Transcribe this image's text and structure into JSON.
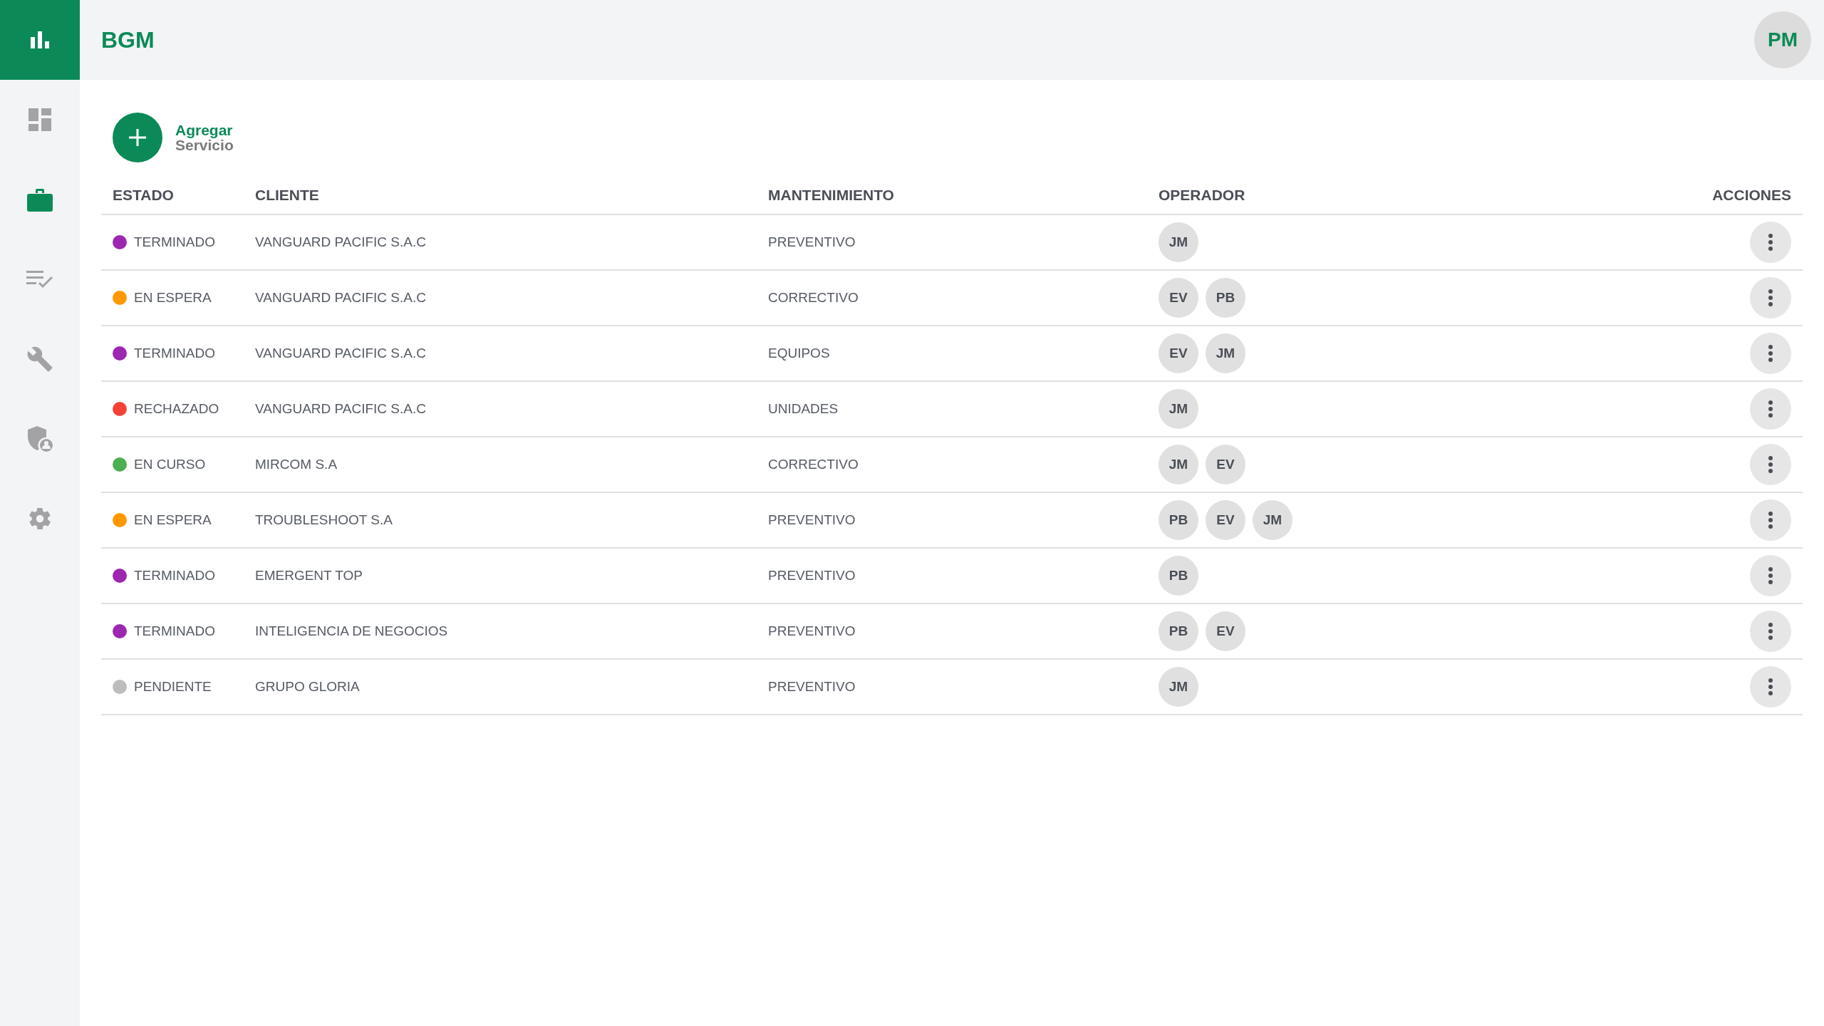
{
  "header": {
    "brand": "BGM",
    "user_initials": "PM"
  },
  "sidebar": {
    "items": [
      {
        "kind": "dashboard",
        "selected": false
      },
      {
        "kind": "services",
        "selected": true
      },
      {
        "kind": "checklist",
        "selected": false
      },
      {
        "kind": "tools",
        "selected": false
      },
      {
        "kind": "security",
        "selected": false
      },
      {
        "kind": "settings",
        "selected": false
      }
    ]
  },
  "add_button": {
    "label_line_1": "Agregar",
    "label_line_2": "Servicio"
  },
  "table": {
    "columns": [
      "ESTADO",
      "CLIENTE",
      "MANTENIMIENTO",
      "OPERADOR",
      "ACCIONES"
    ],
    "rows": [
      {
        "status": "TERMINADO",
        "color": "#9c27b0",
        "client": "VANGUARD PACIFIC S.A.C",
        "maintenance": "PREVENTIVO",
        "operators": [
          "JM"
        ]
      },
      {
        "status": "EN ESPERA",
        "color": "#ff9800",
        "client": "VANGUARD PACIFIC S.A.C",
        "maintenance": "CORRECTIVO",
        "operators": [
          "EV",
          "PB"
        ]
      },
      {
        "status": "TERMINADO",
        "color": "#9c27b0",
        "client": "VANGUARD PACIFIC S.A.C",
        "maintenance": "EQUIPOS",
        "operators": [
          "EV",
          "JM"
        ]
      },
      {
        "status": "RECHAZADO",
        "color": "#f44336",
        "client": "VANGUARD PACIFIC S.A.C",
        "maintenance": "UNIDADES",
        "operators": [
          "JM"
        ]
      },
      {
        "status": "EN CURSO",
        "color": "#4caf50",
        "client": "MIRCOM S.A",
        "maintenance": "CORRECTIVO",
        "operators": [
          "JM",
          "EV"
        ]
      },
      {
        "status": "EN ESPERA",
        "color": "#ff9800",
        "client": "TROUBLESHOOT S.A",
        "maintenance": "PREVENTIVO",
        "operators": [
          "PB",
          "EV",
          "JM"
        ]
      },
      {
        "status": "TERMINADO",
        "color": "#9c27b0",
        "client": "EMERGENT TOP",
        "maintenance": "PREVENTIVO",
        "operators": [
          "PB"
        ]
      },
      {
        "status": "TERMINADO",
        "color": "#9c27b0",
        "client": "INTELIGENCIA DE NEGOCIOS",
        "maintenance": "PREVENTIVO",
        "operators": [
          "PB",
          "EV"
        ]
      },
      {
        "status": "PENDIENTE",
        "color": "#bdbdbd",
        "client": "GRUPO GLORIA",
        "maintenance": "PREVENTIVO",
        "operators": [
          "JM"
        ]
      }
    ]
  }
}
